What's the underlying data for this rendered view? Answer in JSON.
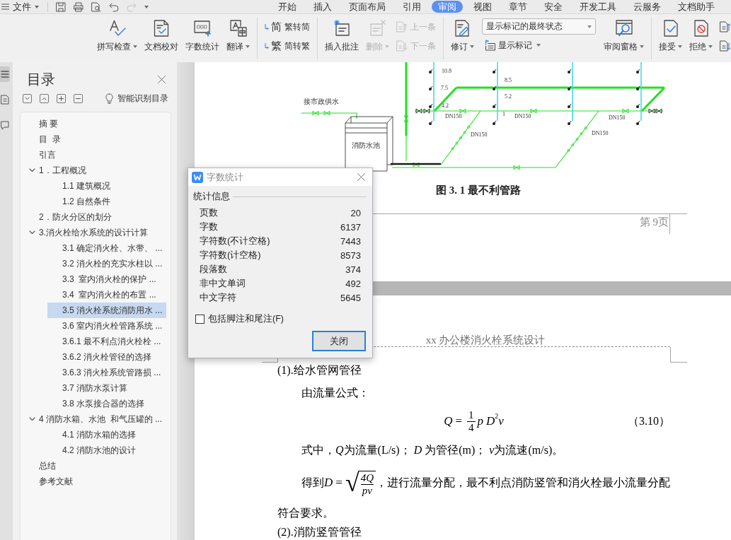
{
  "menu_bar": {
    "file_menu": "文件",
    "quick_access": [
      {
        "disabled": false
      },
      {
        "disabled": false
      },
      {
        "disabled": false
      },
      {
        "disabled": false
      },
      {
        "disabled": true
      }
    ],
    "tabs": [
      {
        "label": "开始",
        "selected": false
      },
      {
        "label": "插入",
        "selected": false
      },
      {
        "label": "页面布局",
        "selected": false
      },
      {
        "label": "引用",
        "selected": false
      },
      {
        "label": "审阅",
        "selected": true
      },
      {
        "label": "视图",
        "selected": false
      },
      {
        "label": "章节",
        "selected": false
      },
      {
        "label": "安全",
        "selected": false
      },
      {
        "label": "开发工具",
        "selected": false
      },
      {
        "label": "云服务",
        "selected": false
      },
      {
        "label": "文档助手",
        "selected": false
      }
    ]
  },
  "ribbon": {
    "groups": [
      {
        "items": [
          {
            "kind": "large",
            "label": "拼写检查",
            "dropdown": true,
            "disabled": false
          },
          {
            "kind": "large",
            "label": "文档校对",
            "dropdown": false,
            "disabled": false
          },
          {
            "kind": "large",
            "label": "字数统计",
            "dropdown": false,
            "disabled": false
          },
          {
            "kind": "large",
            "label": "翻译",
            "dropdown": true,
            "disabled": false
          }
        ]
      },
      {
        "items": [
          {
            "kind": "stack",
            "rows": [
              {
                "glyph": "简",
                "label": "繁转简",
                "disabled": false
              },
              {
                "glyph": "繁",
                "label": "简转繁",
                "disabled": false
              }
            ]
          }
        ]
      },
      {
        "items": [
          {
            "kind": "large",
            "label": "插入批注",
            "dropdown": false,
            "disabled": false
          },
          {
            "kind": "large",
            "label": "删除",
            "dropdown": true,
            "disabled": true
          },
          {
            "kind": "stack",
            "rows": [
              {
                "label": "上一条",
                "disabled": true
              },
              {
                "label": "下一条",
                "disabled": true
              }
            ]
          }
        ]
      },
      {
        "items": [
          {
            "kind": "large",
            "label": "修订",
            "dropdown": true,
            "disabled": false
          },
          {
            "kind": "combo",
            "value": "显示标记的最终状态",
            "button": "显示标记",
            "dropdown": true
          },
          {
            "kind": "large",
            "label": "审阅窗格",
            "dropdown": true,
            "disabled": false
          }
        ]
      },
      {
        "items": [
          {
            "kind": "large",
            "label": "接受",
            "dropdown": true,
            "disabled": false
          },
          {
            "kind": "large",
            "label": "拒绝",
            "dropdown": true,
            "disabled": false
          },
          {
            "kind": "stack",
            "rows": [
              {
                "disabled": false
              },
              {
                "disabled": false
              }
            ]
          }
        ]
      }
    ]
  },
  "sidebar": {
    "rail": [
      {
        "selected": true
      },
      {
        "selected": false
      },
      {
        "selected": false
      }
    ],
    "title": "目录",
    "smart_toc": "智能识别目录",
    "toc": [
      {
        "label": "摘 要",
        "selected": false
      },
      {
        "label": "目  录",
        "selected": false
      },
      {
        "label": "引言",
        "selected": false
      },
      {
        "label": "1．工程概况",
        "selected": false,
        "expanded": true,
        "children": [
          {
            "label": "1.1 建筑概况",
            "selected": false
          },
          {
            "label": "1.2 自然条件",
            "selected": false
          }
        ]
      },
      {
        "label": "2．防火分区的划分",
        "selected": false
      },
      {
        "label": "3.消火栓给水系统的设计计算",
        "selected": false,
        "expanded": true,
        "children": [
          {
            "label": "3.1 确定消火栓、水带、 ...",
            "selected": false
          },
          {
            "label": "3.2 消火栓的充实水柱以 ...",
            "selected": false
          },
          {
            "label": "3.3  室内消火栓的保护 ...",
            "selected": false
          },
          {
            "label": "3.4  室内消火栓的布置 ...",
            "selected": false
          },
          {
            "label": "3.5 消火栓系统消防用水 ...",
            "selected": true
          },
          {
            "label": "3.6 室内消火栓管路系统 ...",
            "selected": false
          },
          {
            "label": "3.6.1 最不利点消火栓栓 ...",
            "selected": false
          },
          {
            "label": "3.6.2 消火栓管径的选择",
            "selected": false
          },
          {
            "label": "3.6.3 消火栓系统管路损 ...",
            "selected": false
          },
          {
            "label": "3.7 消防水泵计算",
            "selected": false
          },
          {
            "label": "3.8 水泵接合器的选择",
            "selected": false
          }
        ]
      },
      {
        "label": "4 消防水箱、水池  和气压罐的 ...",
        "selected": false,
        "expanded": true,
        "children": [
          {
            "label": "4.1 消防水箱的选择",
            "selected": false
          },
          {
            "label": "4.2 消防水池的设计",
            "selected": false
          }
        ]
      },
      {
        "label": "总结",
        "selected": false
      },
      {
        "label": "参考文献",
        "selected": false
      }
    ]
  },
  "document": {
    "figure": {
      "labels": [
        {
          "kind": "note",
          "text": "接市政供水"
        },
        {
          "kind": "note",
          "text": "消防水池"
        },
        {
          "kind": "dimension",
          "text": "10.8"
        },
        {
          "kind": "dimension",
          "text": "7.5"
        },
        {
          "kind": "dimension",
          "text": "4.2"
        },
        {
          "kind": "dimension",
          "text": "8.5"
        },
        {
          "kind": "dimension",
          "text": "5.2"
        },
        {
          "kind": "dimension",
          "text": "1"
        },
        {
          "kind": "dimension",
          "text": "DN150"
        },
        {
          "kind": "dimension",
          "text": "DN150"
        },
        {
          "kind": "dimension",
          "text": "DN150"
        },
        {
          "kind": "dimension",
          "text": "DN150"
        },
        {
          "kind": "dimension",
          "text": "DN150"
        }
      ],
      "caption": "图 3. 1 最不利管路"
    },
    "page_number": "第 9页",
    "header": "xx 办公楼消火栓系统设计",
    "paragraphs": [
      {
        "kind": "heading",
        "text": "(1).给水管网管径"
      },
      {
        "kind": "indent",
        "text": "由流量公式："
      },
      {
        "kind": "equation",
        "formula": {
          "lhs": "Q",
          "equals": "=",
          "numerator": "1",
          "denominator": "4",
          "factor": "p",
          "base": "D",
          "exponent": "2",
          "tail": "v"
        },
        "number": "（3.10）"
      },
      {
        "kind": "mixed",
        "segments": [
          {
            "text": "式中，",
            "italic": false
          },
          {
            "text": "Q",
            "italic": true
          },
          {
            "text": "为流量(L/s)； ",
            "italic": false
          },
          {
            "text": "D",
            "italic": true
          },
          {
            "text": " 为管径(m)； ",
            "italic": false
          },
          {
            "text": "v",
            "italic": true
          },
          {
            "text": "为流速(m/s)。",
            "italic": false
          }
        ]
      },
      {
        "kind": "root",
        "before": "得到",
        "formula": {
          "lhs": "D",
          "equals": "=",
          "radical": "√",
          "numerator": "4Q",
          "denominator": "pv"
        },
        "after": "，进行流量分配，最不利点消防竖管和消火栓最小流量分配"
      },
      {
        "kind": "plain",
        "text": "符合要求。"
      },
      {
        "kind": "heading",
        "text": "(2).消防竖管管径"
      }
    ]
  },
  "dialog": {
    "title": "字数统计",
    "section": "统计信息",
    "stats": [
      {
        "label": "页数",
        "value": "20"
      },
      {
        "label": "字数",
        "value": "6137"
      },
      {
        "label": "字符数(不计空格)",
        "value": "7443"
      },
      {
        "label": "字符数(计空格)",
        "value": "8573"
      },
      {
        "label": "段落数",
        "value": "374"
      },
      {
        "label": "非中文单词",
        "value": "492"
      },
      {
        "label": "中文字符",
        "value": "5645"
      }
    ],
    "include_notes": {
      "label": "包括脚注和尾注(F)",
      "checked": false
    },
    "close_button": {
      "label": "关闭",
      "focused": true
    }
  }
}
